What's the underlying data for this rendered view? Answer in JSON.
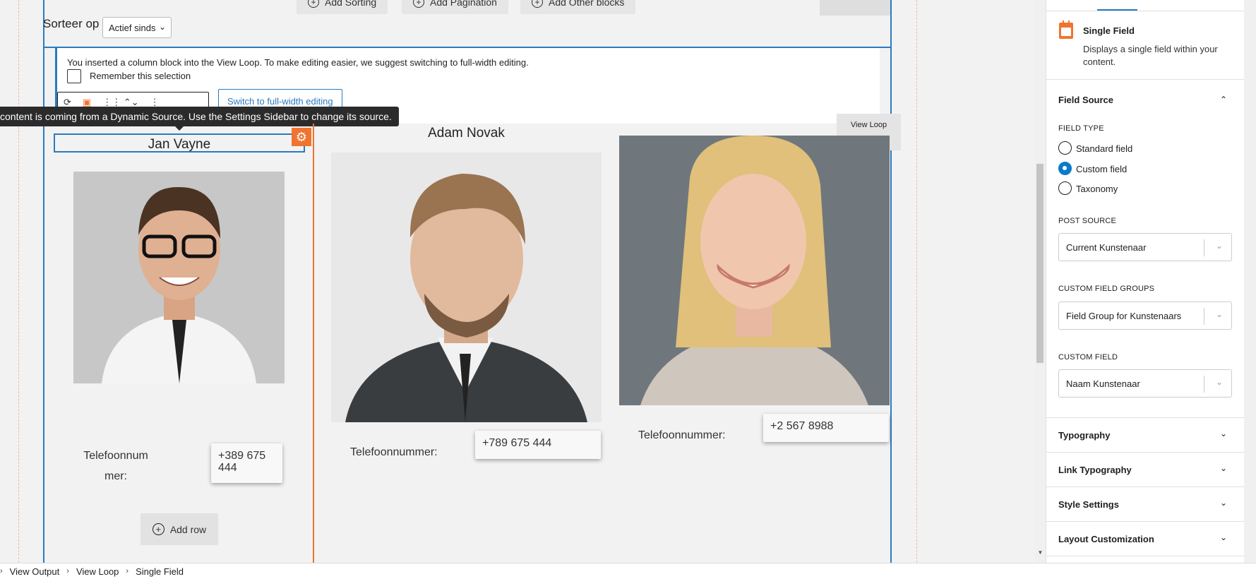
{
  "toolbar": {
    "add_sorting": "Add Sorting",
    "add_pagination": "Add Pagination",
    "add_other_blocks": "Add Other blocks"
  },
  "sort": {
    "label": "Sorteer op",
    "selected": "Actief sinds"
  },
  "notice": {
    "text": "You inserted a column block into the View Loop. To make editing easier, we suggest switching to full-width editing.",
    "remember_label": "Remember this selection",
    "switch_button": "Switch to full-width editing"
  },
  "tooltip": "content is coming from a Dynamic Source. Use the Settings Sidebar to change its source.",
  "view_loop_tag": "View Loop",
  "cards": [
    {
      "name": "Jan Vayne",
      "phone_label": "Telefoonnummer:",
      "phone_label_line1": "Telefoonnum",
      "phone_label_line2": "mer:",
      "phone": "+389 675 444",
      "phone_line1": "+389 675",
      "phone_line2": "444"
    },
    {
      "name": "Adam Novak",
      "phone_label": "Telefoonnummer:",
      "phone": "+789 675 444"
    },
    {
      "name": "",
      "phone_label": "Telefoonnummer:",
      "phone": "+2 567 8988"
    }
  ],
  "add_row": "Add row",
  "sidebar": {
    "block_title": "Single Field",
    "block_desc": "Displays a single field within your content.",
    "field_source": {
      "title": "Field Source",
      "field_type_label": "FIELD TYPE",
      "options": [
        "Standard field",
        "Custom field",
        "Taxonomy"
      ],
      "selected": "Custom field",
      "post_source_label": "POST SOURCE",
      "post_source": "Current Kunstenaar",
      "groups_label": "CUSTOM FIELD GROUPS",
      "groups": "Field Group for Kunstenaars",
      "custom_field_label": "CUSTOM FIELD",
      "custom_field": "Naam Kunstenaar"
    },
    "panels": [
      "Typography",
      "Link Typography",
      "Style Settings",
      "Layout Customization"
    ]
  },
  "breadcrumb": [
    "View Output",
    "View Loop",
    "Single Field"
  ],
  "colors": {
    "accent": "#2a7bbf",
    "orange": "#f0742f",
    "radio": "#0a7ac9"
  }
}
